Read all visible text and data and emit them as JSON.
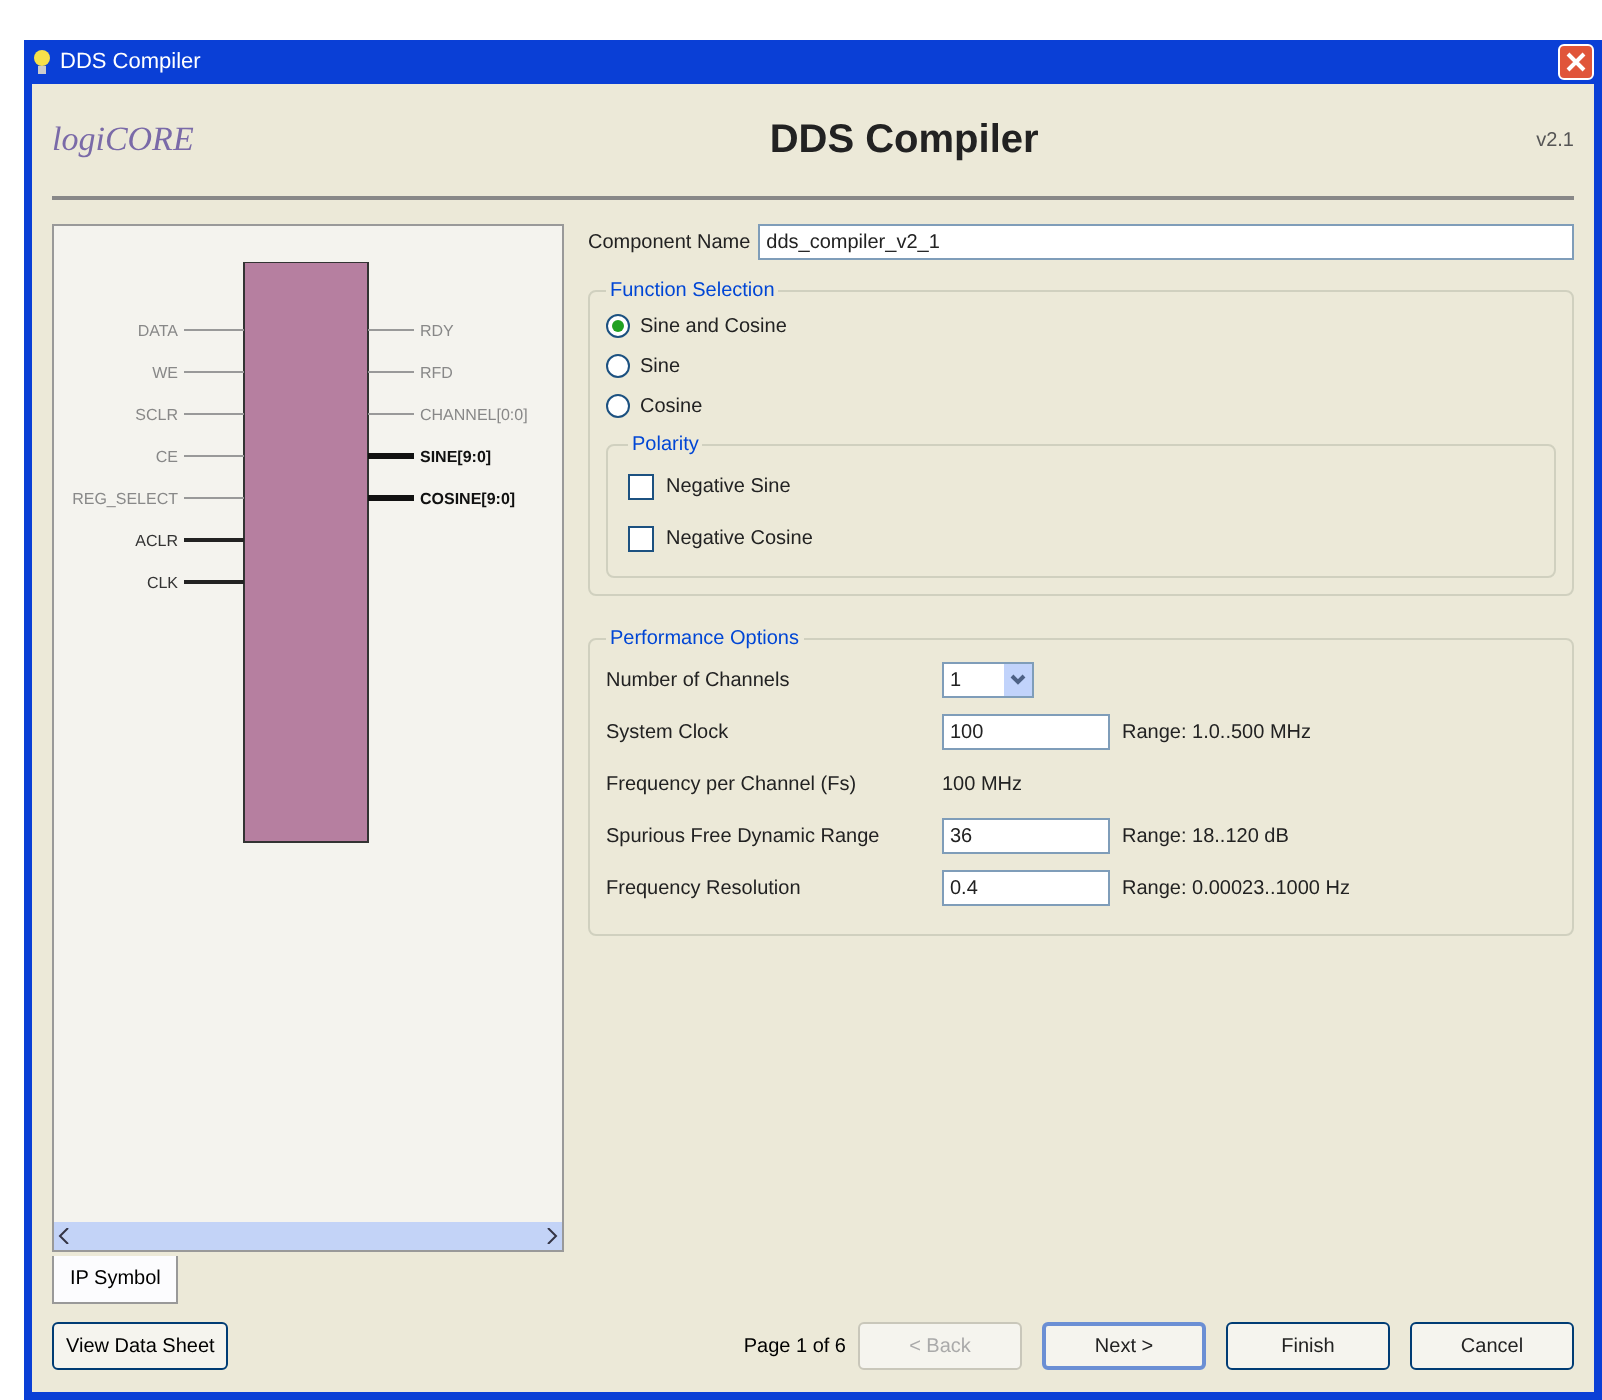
{
  "window": {
    "title": "DDS Compiler"
  },
  "header": {
    "logo": "logiCORE",
    "title": "DDS Compiler",
    "version": "v2.1"
  },
  "symbol": {
    "inputs": [
      {
        "name": "DATA",
        "bus": false
      },
      {
        "name": "WE",
        "bus": false
      },
      {
        "name": "SCLR",
        "bus": false
      },
      {
        "name": "CE",
        "bus": false
      },
      {
        "name": "REG_SELECT",
        "bus": false
      },
      {
        "name": "ACLR",
        "bus": true
      },
      {
        "name": "CLK",
        "bus": true
      }
    ],
    "outputs": [
      {
        "name": "RDY",
        "bus": false
      },
      {
        "name": "RFD",
        "bus": false
      },
      {
        "name": "CHANNEL[0:0]",
        "bus": false
      },
      {
        "name": "SINE[9:0]",
        "bus": true
      },
      {
        "name": "COSINE[9:0]",
        "bus": true
      }
    ],
    "tab": "IP Symbol"
  },
  "component_name": {
    "label": "Component Name",
    "value": "dds_compiler_v2_1"
  },
  "function_selection": {
    "title": "Function Selection",
    "options": [
      {
        "label": "Sine and Cosine",
        "selected": true
      },
      {
        "label": "Sine",
        "selected": false
      },
      {
        "label": "Cosine",
        "selected": false
      }
    ],
    "polarity": {
      "title": "Polarity",
      "options": [
        {
          "label": "Negative Sine",
          "checked": false
        },
        {
          "label": "Negative Cosine",
          "checked": false
        }
      ]
    }
  },
  "performance_options": {
    "title": "Performance Options",
    "rows": [
      {
        "kind": "select",
        "label": "Number of Channels",
        "value": "1"
      },
      {
        "kind": "input",
        "label": "System Clock",
        "value": "100",
        "range": "Range: 1.0..500 MHz"
      },
      {
        "kind": "text",
        "label": "Frequency per Channel (Fs)",
        "value": "100 MHz"
      },
      {
        "kind": "input",
        "label": "Spurious Free Dynamic Range",
        "value": "36",
        "range": "Range: 18..120 dB"
      },
      {
        "kind": "input",
        "label": "Frequency Resolution",
        "value": "0.4",
        "range": "Range: 0.00023..1000 Hz"
      }
    ]
  },
  "footer": {
    "data_sheet": "View Data Sheet",
    "page": "Page 1 of 6",
    "buttons": [
      {
        "label": "< Back",
        "disabled": true,
        "default": false
      },
      {
        "label": "Next >",
        "disabled": false,
        "default": true
      },
      {
        "label": "Finish",
        "disabled": false,
        "default": false
      },
      {
        "label": "Cancel",
        "disabled": false,
        "default": false
      }
    ]
  }
}
